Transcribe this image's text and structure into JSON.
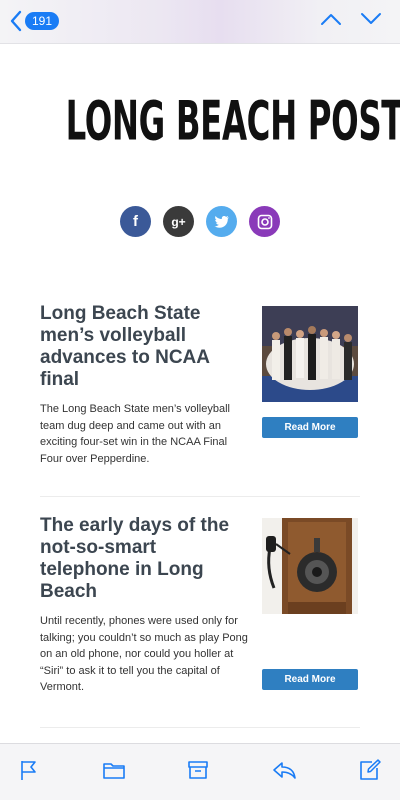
{
  "nav": {
    "unread_count": "191"
  },
  "masthead": {
    "title": "LONG BEACH POST"
  },
  "social": [
    {
      "name": "facebook",
      "glyph": "f"
    },
    {
      "name": "google-plus",
      "glyph": "g+"
    },
    {
      "name": "twitter",
      "glyph": "t"
    },
    {
      "name": "instagram",
      "glyph": "◎"
    }
  ],
  "articles": [
    {
      "title": "Long Beach State men’s volleyball advances to NCAA final",
      "body": "The Long Beach State men’s volleyball team dug deep and came out with an exciting four-set win in the NCAA Final Four over Pepperdine.",
      "cta": "Read More"
    },
    {
      "title": "The early days of the not-so-smart telephone in Long Beach",
      "body": "Until recently, phones were used only for talking; you couldn’t so much as play Pong on an old phone, nor could you holler at “Siri” to ask it to tell you the capital of Vermont.",
      "cta": "Read More"
    }
  ],
  "toolbar": [
    "flag-icon",
    "folder-icon",
    "archive-icon",
    "reply-icon",
    "compose-icon"
  ],
  "colors": {
    "accent": "#1a7cf5",
    "button": "#2f7fc1",
    "headline": "#3c4650"
  }
}
